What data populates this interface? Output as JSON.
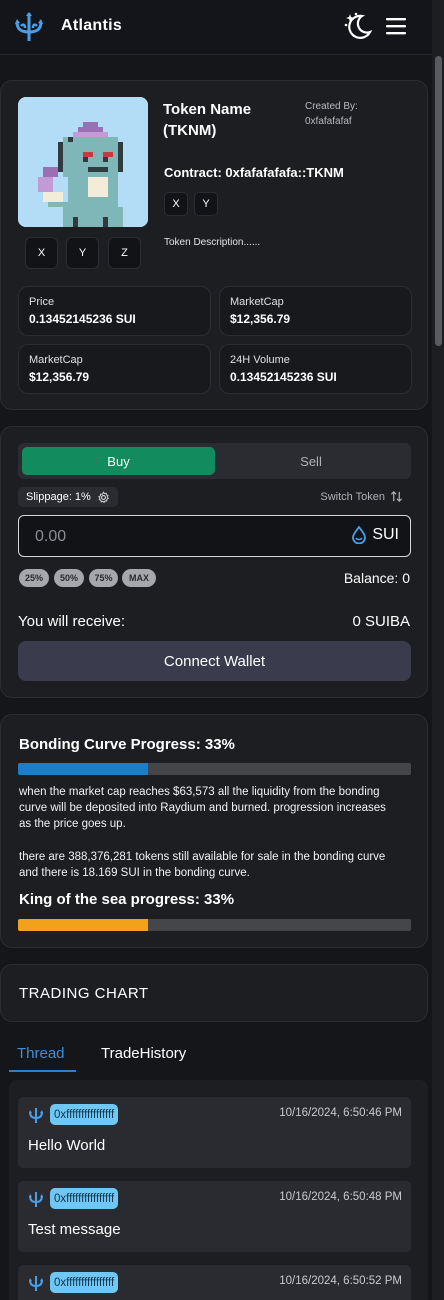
{
  "app": {
    "brand": "Atlantis",
    "accent": "#3d8fd8"
  },
  "token": {
    "name": "Token Name (TKNM)",
    "created_by_label": "Created By:",
    "created_by_value": "0xfafafafaf",
    "contract": "Contract: 0xfafafafafa::TKNM",
    "social_small": [
      "X",
      "Y"
    ],
    "social_big": [
      "X",
      "Y",
      "Z"
    ],
    "description": "Token Description......"
  },
  "stats": [
    {
      "label": "Price",
      "value": "0.13452145236 SUI"
    },
    {
      "label": "MarketCap",
      "value": "$12,356.79"
    },
    {
      "label": "MarketCap",
      "value": "$12,356.79"
    },
    {
      "label": "24H Volume",
      "value": "0.13452145236 SUI"
    }
  ],
  "trade": {
    "buy_label": "Buy",
    "sell_label": "Sell",
    "buy_color": "#128b5e",
    "slippage": "Slippage: 1%",
    "switch_token": "Switch Token",
    "amount_placeholder": "0.00",
    "unit": "SUI",
    "percent_buttons": [
      "25%",
      "50%",
      "75%",
      "MAX"
    ],
    "balance": "Balance: 0",
    "receive_label": "You will receive:",
    "receive_value": "0 SUIBA",
    "connect_label": "Connect Wallet"
  },
  "bonding": {
    "title": "Bonding Curve Progress: 33%",
    "progress": 0.33,
    "progress_color": "#1a7fc9",
    "text1": "when the market cap reaches $63,573 all the liquidity from the bonding curve will be deposited into Raydium and burned. progression increases as the price goes up.",
    "text2": "there are 388,376,281 tokens still available for sale in the bonding curve and there is 18.169 SUI in the bonding curve.",
    "king_title": "King of the sea progress: 33%",
    "king_progress": 0.33,
    "king_color": "#f3a11a"
  },
  "chart": {
    "title": "TRADING CHART"
  },
  "thread_tabs": {
    "thread": "Thread",
    "history": "TradeHistory"
  },
  "messages": [
    {
      "address": "0xffffffffffffffff",
      "time": "10/16/2024, 6:50:46 PM",
      "text": "Hello World"
    },
    {
      "address": "0xffffffffffffffff",
      "time": "10/16/2024, 6:50:48 PM",
      "text": "Test message"
    },
    {
      "address": "0xffffffffffffffff",
      "time": "10/16/2024, 6:50:52 PM",
      "text": ""
    }
  ]
}
